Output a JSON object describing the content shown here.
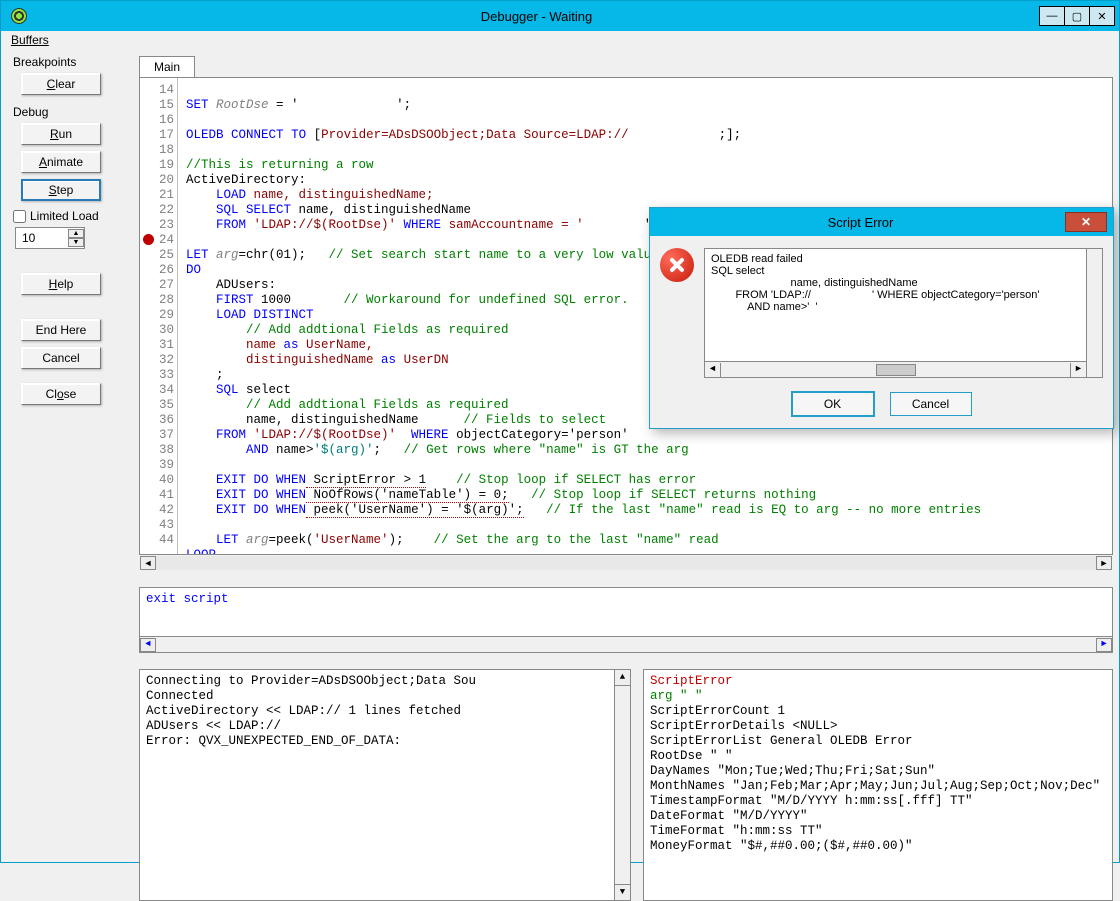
{
  "titlebar": {
    "title": "Debugger - Waiting"
  },
  "menubar": {
    "buffers": "Buffers"
  },
  "panel": {
    "breakpoints_label": "Breakpoints",
    "clear": "Clear",
    "debug_label": "Debug",
    "run": "Run",
    "animate": "Animate",
    "step": "Step",
    "limited_load": "Limited Load",
    "limited_value": "10",
    "help": "Help",
    "end_here": "End Here",
    "cancel": "Cancel",
    "close": "Close"
  },
  "tab": {
    "main": "Main"
  },
  "code": {
    "lines": [
      14,
      15,
      16,
      17,
      18,
      19,
      20,
      21,
      22,
      23,
      24,
      25,
      26,
      27,
      28,
      29,
      30,
      31,
      32,
      33,
      34,
      35,
      36,
      37,
      38,
      39,
      40,
      41,
      42,
      43,
      44
    ],
    "l14a": "SET",
    "l14b": "RootDse",
    "l14c": " = '",
    "l14d": "             ",
    "l14e": "';",
    "l16a": "OLEDB",
    "l16b": "CONNECT",
    "l16c": "TO",
    "l16d": " [",
    "l16e": "Provider=ADsDSOObject;Data Source=LDAP://",
    "l16f": "            ",
    "l16g": ";];",
    "l18": "//This is returning a row",
    "l19": "ActiveDirectory:",
    "l20a": "    LOAD",
    "l20b": " name, distinguishedName;",
    "l21a": "    SQL",
    "l21b": " SELECT",
    "l21c": " name, distinguishedName",
    "l22a": "    FROM",
    "l22b": " 'LDAP://$(RootDse)'",
    "l22c": " WHERE",
    "l22d": " samAccountname = '",
    "l22e": "        ",
    "l22f": "';",
    "l24a": "LET",
    "l24b": " arg",
    "l24c": "=chr(01);",
    "l24d": "   // Set search start name to a very low value",
    "l25": "DO",
    "l26": "    ADUsers:",
    "l27a": "    FIRST",
    "l27b": " 1000",
    "l27c": "       // Workaround for undefined SQL error.",
    "l28a": "    LOAD",
    "l28b": " DISTINCT",
    "l29": "        // Add addtional Fields as required",
    "l30a": "        name ",
    "l30b": "as",
    "l30c": " UserName,",
    "l31a": "        distinguishedName ",
    "l31b": "as",
    "l31c": " UserDN",
    "l32": "    ;",
    "l33a": "    SQL",
    "l33b": " select",
    "l34": "        // Add addtional Fields as required",
    "l35a": "        name, distinguishedName",
    "l35b": "      // Fields to select",
    "l36a": "    FROM",
    "l36b": " 'LDAP://$(RootDse)'",
    "l36c": "  WHERE",
    "l36d": " objectCategory='person'",
    "l37a": "        AND",
    "l37b": " name>",
    "l37c": "'$(arg)'",
    "l37d": ";",
    "l37e": "   // Get rows where \"name\" is GT the arg",
    "l39a": "    EXIT",
    "l39b": " DO",
    "l39c": " WHEN",
    "l39d": " ScriptError > 1",
    "l39e": "    // Stop loop if SELECT has error",
    "l40a": "    EXIT",
    "l40b": " DO",
    "l40c": " WHEN",
    "l40d": " NoOfRows('nameTable') = 0;",
    "l40e": "   // Stop loop if SELECT returns nothing",
    "l41a": "    EXIT",
    "l41b": " DO",
    "l41c": " WHEN",
    "l41d": " peek('UserName') = '$(arg)';",
    "l41e": "   // If the last \"name\" read is EQ to arg -- no more entries",
    "l43a": "    LET",
    "l43b": " arg",
    "l43c": "=peek(",
    "l43d": "'UserName'",
    "l43e": ");",
    "l43f": "    // Set the arg to the last \"name\" read",
    "l44": "LOOP"
  },
  "exit_script": "exit script",
  "console": {
    "l1": "Connecting to Provider=ADsDSOObject;Data Sou",
    "l2": "Connected",
    "l3": "ActiveDirectory << LDAP://              1 lines fetched",
    "l4": "ADUsers << LDAP://",
    "l5": "Error: QVX_UNEXPECTED_END_OF_DATA:"
  },
  "vars": {
    "l1": "ScriptError",
    "l2": "arg       \"  \"",
    "l3": "ScriptErrorCount 1",
    "l4": "ScriptErrorDetails   <NULL>",
    "l5": "ScriptErrorList  General OLEDB Error",
    "l6": "RootDse  \"              \"",
    "l7": "DayNames \"Mon;Tue;Wed;Thu;Fri;Sat;Sun\"",
    "l8": "MonthNames   \"Jan;Feb;Mar;Apr;May;Jun;Jul;Aug;Sep;Oct;Nov;Dec\"",
    "l9": "TimestampFormat  \"M/D/YYYY h:mm:ss[.fff] TT\"",
    "l10": "DateFormat   \"M/D/YYYY\"",
    "l11": "TimeFormat   \"h:mm:ss TT\"",
    "l12": "MoneyFormat  \"$#,##0.00;($#,##0.00)\""
  },
  "dialog": {
    "title": "Script Error",
    "line1": "OLEDB read failed",
    "line2": "SQL select",
    "line3": "                          name, distinguishedName",
    "line4": "        FROM 'LDAP://                    ' WHERE objectCategory='person'",
    "line5": "            AND name>'  '",
    "ok": "OK",
    "cancel": "Cancel"
  }
}
